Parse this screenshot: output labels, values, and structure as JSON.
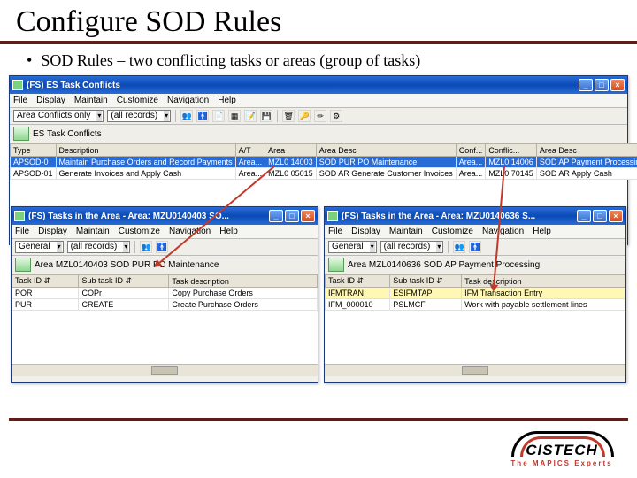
{
  "slide": {
    "title": "Configure SOD Rules",
    "bullet": "SOD Rules – two conflicting tasks or areas (group of tasks)"
  },
  "mainWin": {
    "title": "(FS) ES Task Conflicts",
    "menu": [
      "File",
      "Display",
      "Maintain",
      "Customize",
      "Navigation",
      "Help"
    ],
    "filter1": "Area Conflicts only",
    "filter2": "(all records)",
    "label": "ES Task Conflicts",
    "cols": [
      "Type",
      "Description",
      "A/T",
      "Area",
      "Area Desc",
      "Conf...",
      "Conflic...",
      "Area Desc"
    ],
    "rows": [
      [
        "APSOD-0",
        "Maintain Purchase Orders and Record Payments",
        "Area...",
        "MZL0 14003",
        "SOD PUR PO Maintenance",
        "Area...",
        "MZL0 14006",
        "SOD AP Payment Processing"
      ],
      [
        "APSOD-01",
        "Generate Invoices and Apply Cash",
        "Area...",
        "MZL0 05015",
        "SOD AR Generate Customer Invoices",
        "Area...",
        "MZL0 70145",
        "SOD AR Apply Cash"
      ]
    ]
  },
  "leftWin": {
    "title": "(FS) Tasks in the Area - Area: MZU0140403   SO...",
    "menu": [
      "File",
      "Display",
      "Maintain",
      "Customize",
      "Navigation",
      "Help"
    ],
    "filter1": "General",
    "filter2": "(all records)",
    "label": "Area MZL0140403   SOD PUR PO Maintenance",
    "cols": [
      "Task ID",
      "Sub task ID",
      "Task description"
    ],
    "rows": [
      [
        "POR",
        "COPr",
        "Copy Purchase Orders"
      ],
      [
        "PUR",
        "CREATE",
        "Create Purchase Orders"
      ]
    ]
  },
  "rightWin": {
    "title": "(FS) Tasks in the Area - Area: MZU0140636   S...",
    "menu": [
      "File",
      "Display",
      "Maintain",
      "Customize",
      "Navigation",
      "Help"
    ],
    "filter1": "General",
    "filter2": "(all records)",
    "label": "Area MZL0140636   SOD AP Payment Processing",
    "cols": [
      "Task ID",
      "Sub task ID",
      "Task description"
    ],
    "rows": [
      [
        "IFMTRAN",
        "ESIFMTAP",
        "IFM Transaction Entry"
      ],
      [
        "IFM_000010",
        "PSLMCF",
        "Work with payable settlement lines"
      ]
    ]
  },
  "glyph": {
    "save": "💾",
    "people": "👥",
    "man": "🚹",
    "doc": "📄",
    "tbl": "▦",
    "note": "📝",
    "trash": "🗑",
    "key": "🔑",
    "pencil": "✏",
    "gear": "⚙",
    "sort": "⇵"
  },
  "logo": {
    "name": "CISTECH",
    "tag": "The MAPICS Experts"
  }
}
